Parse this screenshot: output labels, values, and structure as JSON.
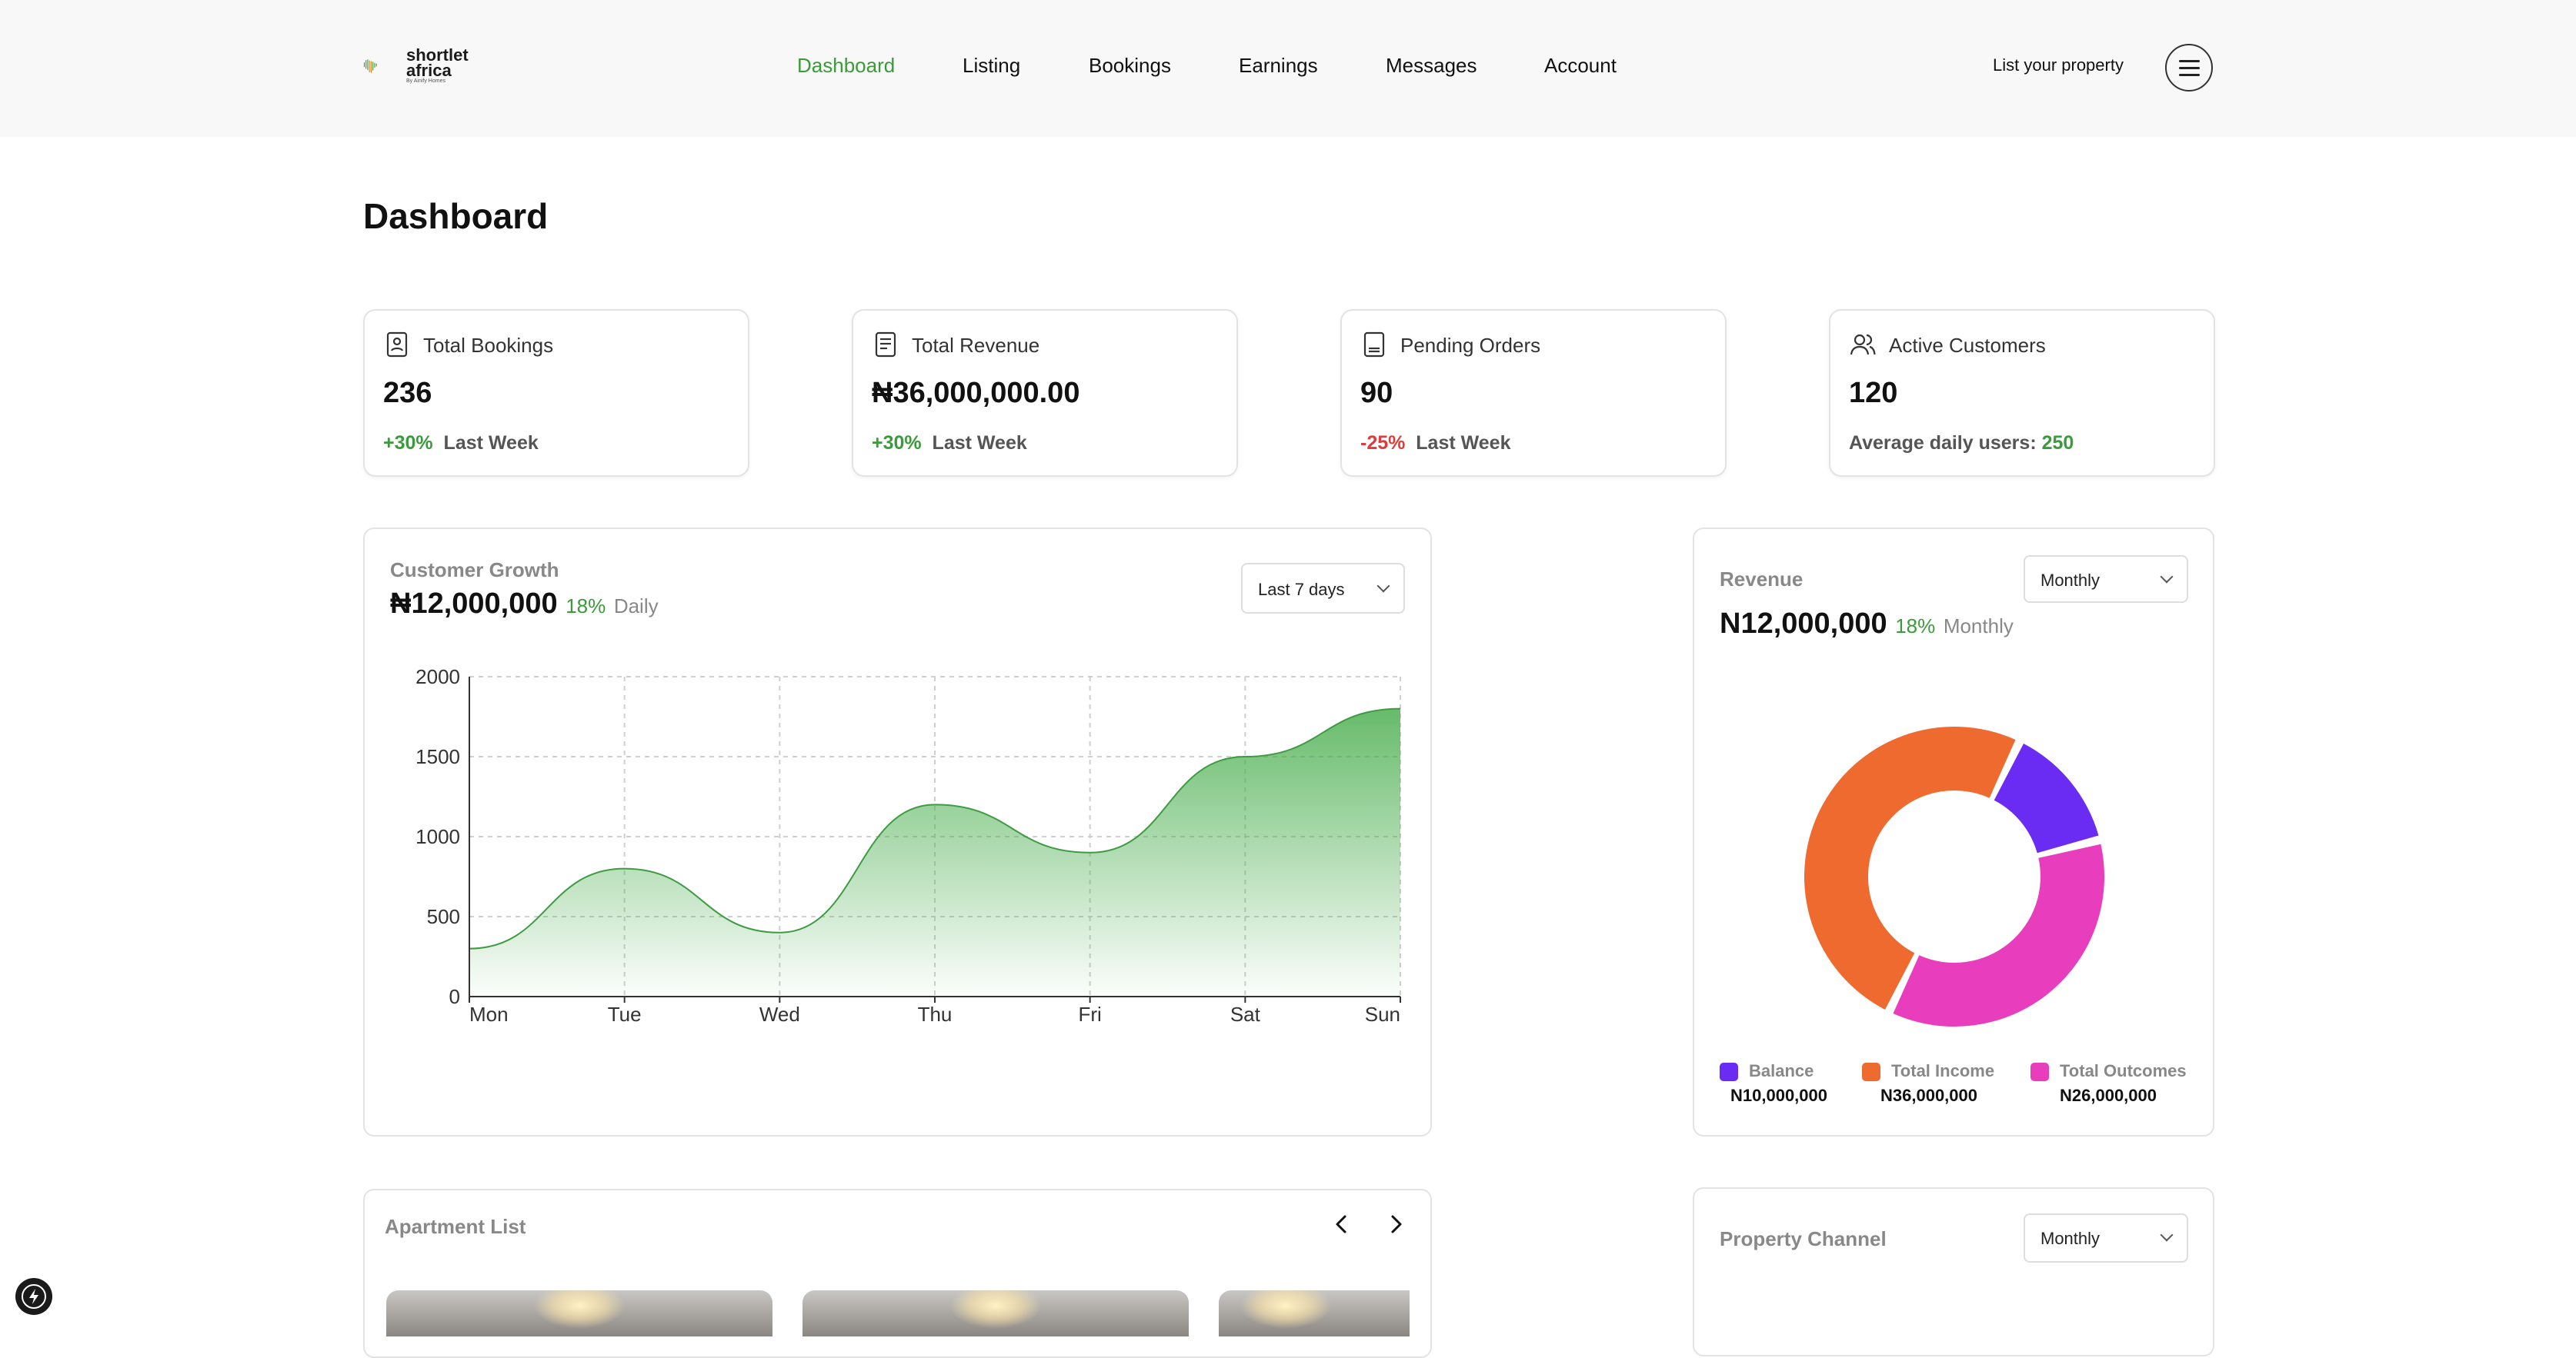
{
  "app": {
    "logo_text_1": "shortlet",
    "logo_text_2": "africa",
    "logo_sub": "By Ainify Homes"
  },
  "nav": [
    {
      "label": "Dashboard",
      "active": true
    },
    {
      "label": "Listing",
      "active": false
    },
    {
      "label": "Bookings",
      "active": false
    },
    {
      "label": "Earnings",
      "active": false
    },
    {
      "label": "Messages",
      "active": false
    },
    {
      "label": "Account",
      "active": false
    }
  ],
  "header": {
    "list_property": "List your property",
    "menu_icon": "hamburger-menu-icon"
  },
  "page_title": "Dashboard",
  "stats": [
    {
      "icon": "contact-book-icon",
      "label": "Total Bookings",
      "value": "236",
      "change": "+30%",
      "period": "Last Week"
    },
    {
      "icon": "document-icon",
      "label": "Total Revenue",
      "value": "₦36,000,000.00",
      "change": "+30%",
      "period": "Last Week"
    },
    {
      "icon": "receipt-icon",
      "label": "Pending Orders",
      "value": "90",
      "change": "-25%",
      "period": "Last Week"
    },
    {
      "icon": "users-icon",
      "label": "Active Customers",
      "value": "120",
      "foot_label": "Average daily users:",
      "foot_value": "250"
    }
  ],
  "customer_growth": {
    "title": "Customer Growth",
    "value": "₦12,000,000",
    "pct": "18%",
    "period": "Daily",
    "range_select": "Last 7 days"
  },
  "revenue": {
    "title": "Revenue",
    "value": "N12,000,000",
    "pct": "18%",
    "period": "Monthly",
    "select": "Monthly",
    "legend": [
      {
        "name": "Balance",
        "amount": "N10,000,000",
        "color": "#6a2bf2"
      },
      {
        "name": "Total Income",
        "amount": "N36,000,000",
        "color": "#ee6a2e"
      },
      {
        "name": "Total Outcomes",
        "amount": "N26,000,000",
        "color": "#e83dbc"
      }
    ]
  },
  "apartment_list": {
    "title": "Apartment List",
    "prev_icon": "chevron-left-icon",
    "next_icon": "chevron-right-icon"
  },
  "property_channel": {
    "title": "Property Channel",
    "select": "Monthly"
  },
  "chart_data": [
    {
      "type": "area",
      "categories": [
        "Mon",
        "Tue",
        "Wed",
        "Thu",
        "Fri",
        "Sat",
        "Sun"
      ],
      "values": [
        300,
        800,
        400,
        1200,
        900,
        1500,
        1800
      ],
      "ylim": [
        0,
        2000
      ],
      "yticks": [
        "0",
        "500",
        "1000",
        "1500",
        "2000"
      ],
      "grid": true,
      "color": "#4caf50"
    },
    {
      "type": "pie",
      "labels": [
        "Balance",
        "Total Income",
        "Total Outcomes"
      ],
      "values": [
        10000000,
        36000000,
        26000000
      ],
      "colors": [
        "#6a2bf2",
        "#ee6a2e",
        "#e83dbc"
      ]
    }
  ],
  "colors": {
    "accent": "#3b9a3b",
    "negative": "#e03b3b"
  }
}
